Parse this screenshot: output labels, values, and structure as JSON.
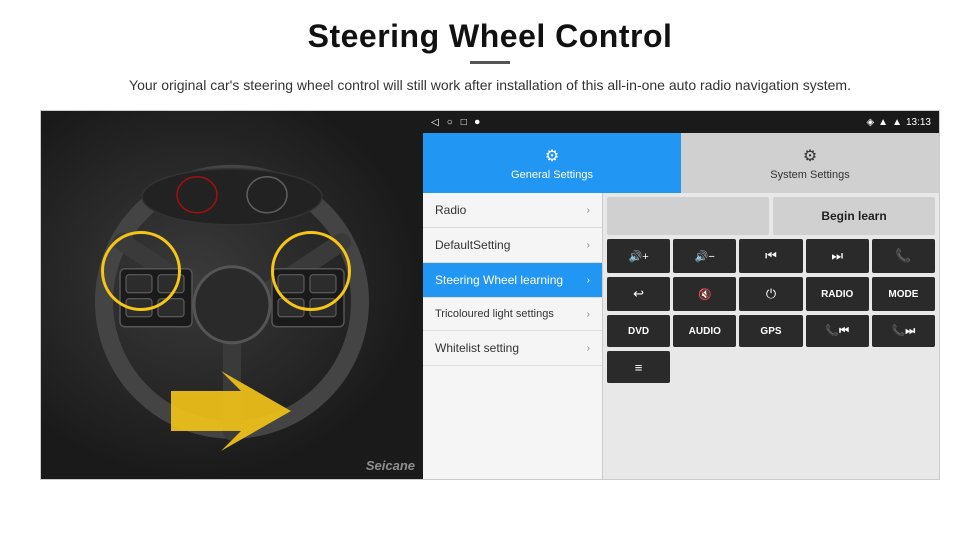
{
  "header": {
    "title": "Steering Wheel Control",
    "divider": true,
    "subtitle": "Your original car's steering wheel control will still work after installation of this all-in-one auto radio navigation system."
  },
  "statusBar": {
    "time": "13:13",
    "icons": [
      "wifi",
      "signal",
      "gps"
    ]
  },
  "navBar": {
    "buttons": [
      "◁",
      "○",
      "□",
      "⏺"
    ]
  },
  "tabs": [
    {
      "label": "General Settings",
      "active": true
    },
    {
      "label": "System Settings",
      "active": false
    }
  ],
  "menuItems": [
    {
      "label": "Radio",
      "active": false
    },
    {
      "label": "DefaultSetting",
      "active": false
    },
    {
      "label": "Steering Wheel learning",
      "active": true
    },
    {
      "label": "Tricoloured light settings",
      "active": false
    },
    {
      "label": "Whitelist setting",
      "active": false
    }
  ],
  "controlPanel": {
    "beginLearnLabel": "Begin learn",
    "row1": [
      {
        "icon": "🔊+",
        "type": "icon"
      },
      {
        "icon": "🔊−",
        "type": "icon"
      },
      {
        "icon": "⏮",
        "type": "icon"
      },
      {
        "icon": "⏭",
        "type": "icon"
      },
      {
        "icon": "📞",
        "type": "icon"
      }
    ],
    "row2": [
      {
        "icon": "↩",
        "type": "icon"
      },
      {
        "icon": "🔇",
        "type": "icon"
      },
      {
        "icon": "⏻",
        "type": "icon"
      },
      {
        "label": "RADIO",
        "type": "label"
      },
      {
        "label": "MODE",
        "type": "label"
      }
    ],
    "row3": [
      {
        "label": "DVD",
        "type": "label"
      },
      {
        "label": "AUDIO",
        "type": "label"
      },
      {
        "label": "GPS",
        "type": "label"
      },
      {
        "icon": "📞⏮",
        "type": "icon"
      },
      {
        "icon": "📞⏭",
        "type": "icon"
      }
    ],
    "row4": [
      {
        "icon": "≡",
        "type": "icon"
      }
    ]
  },
  "watermark": "Seicane"
}
